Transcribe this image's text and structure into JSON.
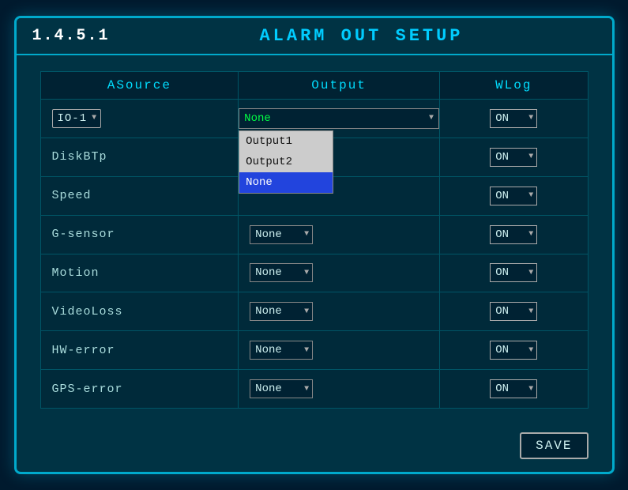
{
  "header": {
    "id": "1.4.5.1",
    "title": "ALARM OUT SETUP"
  },
  "table": {
    "columns": [
      "ASource",
      "Output",
      "WLog"
    ],
    "rows": [
      {
        "source": "IO-1",
        "source_type": "io-select",
        "output": "None",
        "output_open": true,
        "output_options": [
          "Output1",
          "Output2",
          "None"
        ],
        "output_selected": "None",
        "wlog": "ON"
      },
      {
        "source": "DiskBTp",
        "source_type": "label",
        "output": "",
        "output_open": false,
        "wlog": "ON"
      },
      {
        "source": "Speed",
        "source_type": "label",
        "output": "",
        "output_open": false,
        "wlog": "ON"
      },
      {
        "source": "G-sensor",
        "source_type": "label",
        "output": "None",
        "output_open": false,
        "wlog": "ON"
      },
      {
        "source": "Motion",
        "source_type": "label",
        "output": "None",
        "output_open": false,
        "wlog": "ON"
      },
      {
        "source": "VideoLoss",
        "source_type": "label",
        "output": "None",
        "output_open": false,
        "wlog": "ON"
      },
      {
        "source": "HW-error",
        "source_type": "label",
        "output": "None",
        "output_open": false,
        "wlog": "ON"
      },
      {
        "source": "GPS-error",
        "source_type": "label",
        "output": "None",
        "output_open": false,
        "wlog": "ON"
      }
    ]
  },
  "buttons": {
    "save": "SAVE"
  },
  "colors": {
    "accent": "#00aacc",
    "background": "#003344",
    "selected_blue": "#2244dd",
    "green_text": "#00ff44"
  }
}
